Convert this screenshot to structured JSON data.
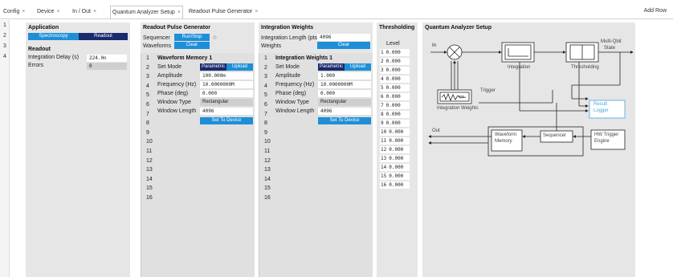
{
  "tabs": [
    {
      "label": "Config"
    },
    {
      "label": "Device"
    },
    {
      "label": "In / Out"
    },
    {
      "label": "Quantum Analyzer Setup",
      "active": true
    },
    {
      "label": "Readout Pulse Generator"
    }
  ],
  "close_glyph": "×",
  "add_row": "Add Row",
  "row_numbers": [
    "1",
    "2",
    "3",
    "4"
  ],
  "application": {
    "title": "Application",
    "btn_spectroscopy": "Spectroscopy",
    "btn_readout": "Readout",
    "readout_title": "Readout",
    "integration_delay_label": "Integration Delay (s)",
    "integration_delay_value": "224.0n",
    "errors_label": "Errors",
    "errors_value": "0"
  },
  "readout_pulse": {
    "title": "Readout Pulse Generator",
    "sequencer_label": "Sequencer",
    "run_stop": "Run/Stop",
    "waveforms_label": "Waveforms",
    "clear": "Clear",
    "memory_title": "Waveform Memory 1",
    "rows": [
      "1",
      "2",
      "3",
      "4",
      "5",
      "6",
      "7",
      "8",
      "9",
      "10",
      "11",
      "12",
      "13",
      "14",
      "15",
      "16"
    ],
    "set_mode_label": "Set Mode",
    "parametric": "Parametric",
    "upload": "Upload",
    "amplitude_label": "Amplitude",
    "amplitude_value": "100.000m",
    "frequency_label": "Frequency (Hz)",
    "frequency_value": "10.0000000M",
    "phase_label": "Phase (deg)",
    "phase_value": "0.000",
    "window_type_label": "Window Type",
    "window_type_value": "Rectangular",
    "window_length_label": "Window Length",
    "window_length_value": "4096",
    "set_to_device": "Set To Device"
  },
  "integration_weights": {
    "title": "Integration Weights",
    "length_label": "Integration Length (pts)",
    "length_value": "4096",
    "weights_label": "Weights",
    "clear": "Clear",
    "sub_title": "Integration Weights 1",
    "rows": [
      "1",
      "2",
      "3",
      "4",
      "5",
      "6",
      "7",
      "8",
      "9",
      "10",
      "11",
      "12",
      "13",
      "14",
      "15",
      "16"
    ],
    "set_mode_label": "Set Mode",
    "parametric": "Parametric",
    "upload": "Upload",
    "amplitude_label": "Amplitude",
    "amplitude_value": "1.000",
    "frequency_label": "Frequency (Hz)",
    "frequency_value": "10.0000000M",
    "phase_label": "Phase (deg)",
    "phase_value": "0.000",
    "window_type_label": "Window Type",
    "window_type_value": "Rectangular",
    "window_length_label": "Window Length",
    "window_length_value": "4096",
    "set_to_device": "Set To Device"
  },
  "thresholding": {
    "title": "Thresholding",
    "level_label": "Level",
    "levels": [
      {
        "n": "1",
        "v": "0.000"
      },
      {
        "n": "2",
        "v": "0.000"
      },
      {
        "n": "3",
        "v": "0.000"
      },
      {
        "n": "4",
        "v": "0.000"
      },
      {
        "n": "5",
        "v": "0.000"
      },
      {
        "n": "6",
        "v": "0.000"
      },
      {
        "n": "7",
        "v": "0.000"
      },
      {
        "n": "8",
        "v": "0.000"
      },
      {
        "n": "9",
        "v": "0.000"
      },
      {
        "n": "10",
        "v": "0.000"
      },
      {
        "n": "11",
        "v": "0.000"
      },
      {
        "n": "12",
        "v": "0.000"
      },
      {
        "n": "13",
        "v": "0.000"
      },
      {
        "n": "14",
        "v": "0.000"
      },
      {
        "n": "15",
        "v": "0.000"
      },
      {
        "n": "16",
        "v": "0.000"
      }
    ]
  },
  "diagram": {
    "title": "Quantum Analyzer Setup",
    "in": "In",
    "integration": "Integration",
    "multi_qbit_1": "Multi-Qbit",
    "multi_qbit_2": "State",
    "thresholding": "Thresholding",
    "trigger": "Trigger",
    "integration_weights": "Integration Weights",
    "result_logger_1": "Result",
    "result_logger_2": "Logger",
    "out": "Out",
    "waveform_memory_1": "Waveform",
    "waveform_memory_2": "Memory",
    "sequencer": "Sequencer",
    "hw_trigger_1": "HW Trigger",
    "hw_trigger_2": "Engine"
  },
  "colors": {
    "accent": "#1e8fd6",
    "dark": "#1a2a6e",
    "result_logger": "#4aa3df"
  }
}
